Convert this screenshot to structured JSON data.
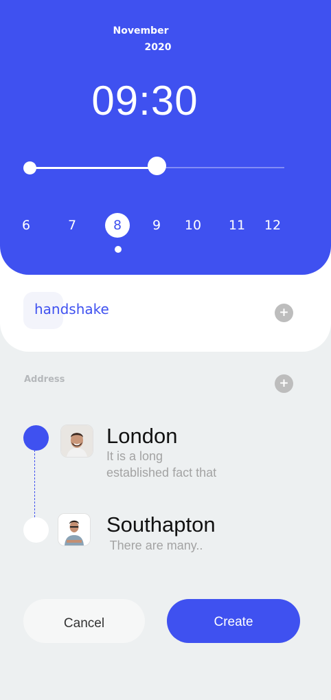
{
  "header": {
    "month": "November",
    "year": "2020",
    "time": "09:30",
    "days": [
      {
        "label": "6",
        "selected": false
      },
      {
        "label": "7",
        "selected": false
      },
      {
        "label": "8",
        "selected": true
      },
      {
        "label": "9",
        "selected": false
      },
      {
        "label": "10",
        "selected": false
      },
      {
        "label": "11",
        "selected": false
      },
      {
        "label": "12",
        "selected": false
      }
    ],
    "accent": "#3f51f0"
  },
  "tag": {
    "label": "handshake"
  },
  "address": {
    "label": "Address",
    "items": [
      {
        "city": "London",
        "desc_line1": "It is a long",
        "desc_line2": "established fact that",
        "avatar": "avatar-man-beard"
      },
      {
        "city": "Southapton",
        "desc_line1": " There are many..",
        "avatar": "avatar-man-arms-crossed"
      }
    ]
  },
  "actions": {
    "cancel": "Cancel",
    "create": "Create"
  }
}
